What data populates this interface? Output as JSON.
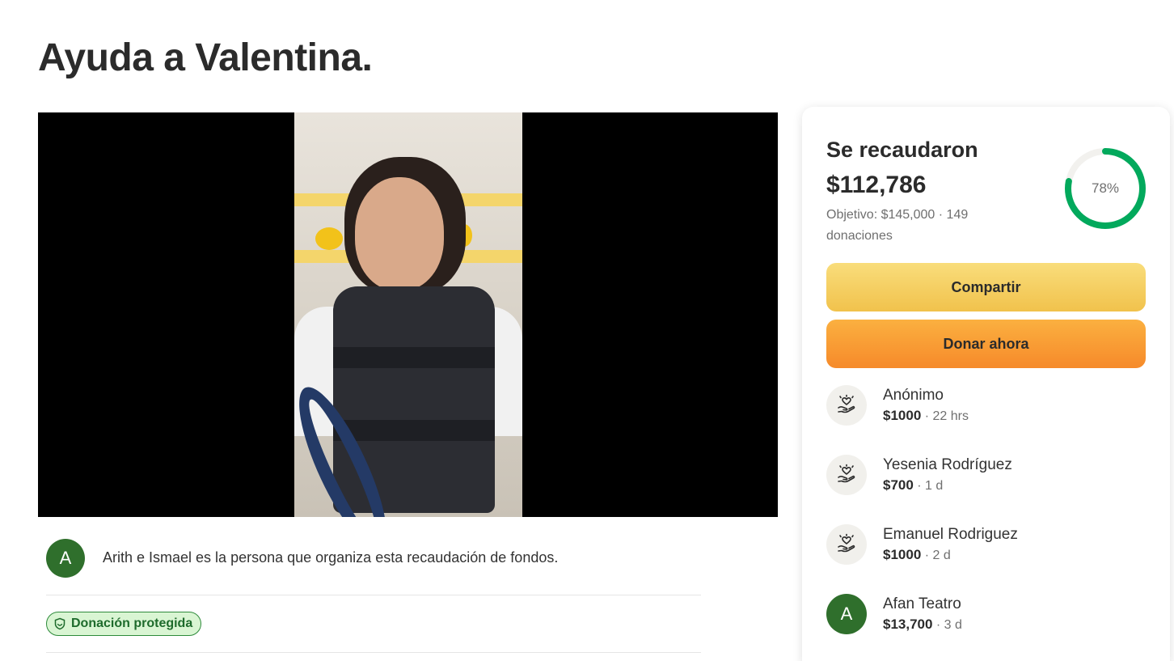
{
  "page": {
    "title": "Ayuda a Valentina."
  },
  "organizer": {
    "avatar_letter": "A",
    "text": "Arith e Ismael es la persona que organiza esta recaudación de fondos."
  },
  "protection": {
    "badge_label": "Donación protegida"
  },
  "summary": {
    "raised_label": "Se recaudaron",
    "raised_amount": "$112,786",
    "goal_text": "Objetivo: $145,000  ·  149 donaciones",
    "progress_percent": 78,
    "progress_label": "78%",
    "progress_color": "#02a95c"
  },
  "actions": {
    "share_label": "Compartir",
    "donate_label": "Donar ahora"
  },
  "donations": [
    {
      "name": "Anónimo",
      "amount": "$1000",
      "time": " · 22 hrs",
      "icon": "heart-hand-icon"
    },
    {
      "name": "Yesenia Rodríguez",
      "amount": "$700",
      "time": " · 1 d",
      "icon": "heart-hand-icon"
    },
    {
      "name": "Emanuel Rodriguez",
      "amount": "$1000",
      "time": " · 2 d",
      "icon": "heart-hand-icon"
    },
    {
      "name": "Afan Teatro",
      "amount": "$13,700",
      "time": " · 3 d",
      "avatar_letter": "A"
    }
  ]
}
